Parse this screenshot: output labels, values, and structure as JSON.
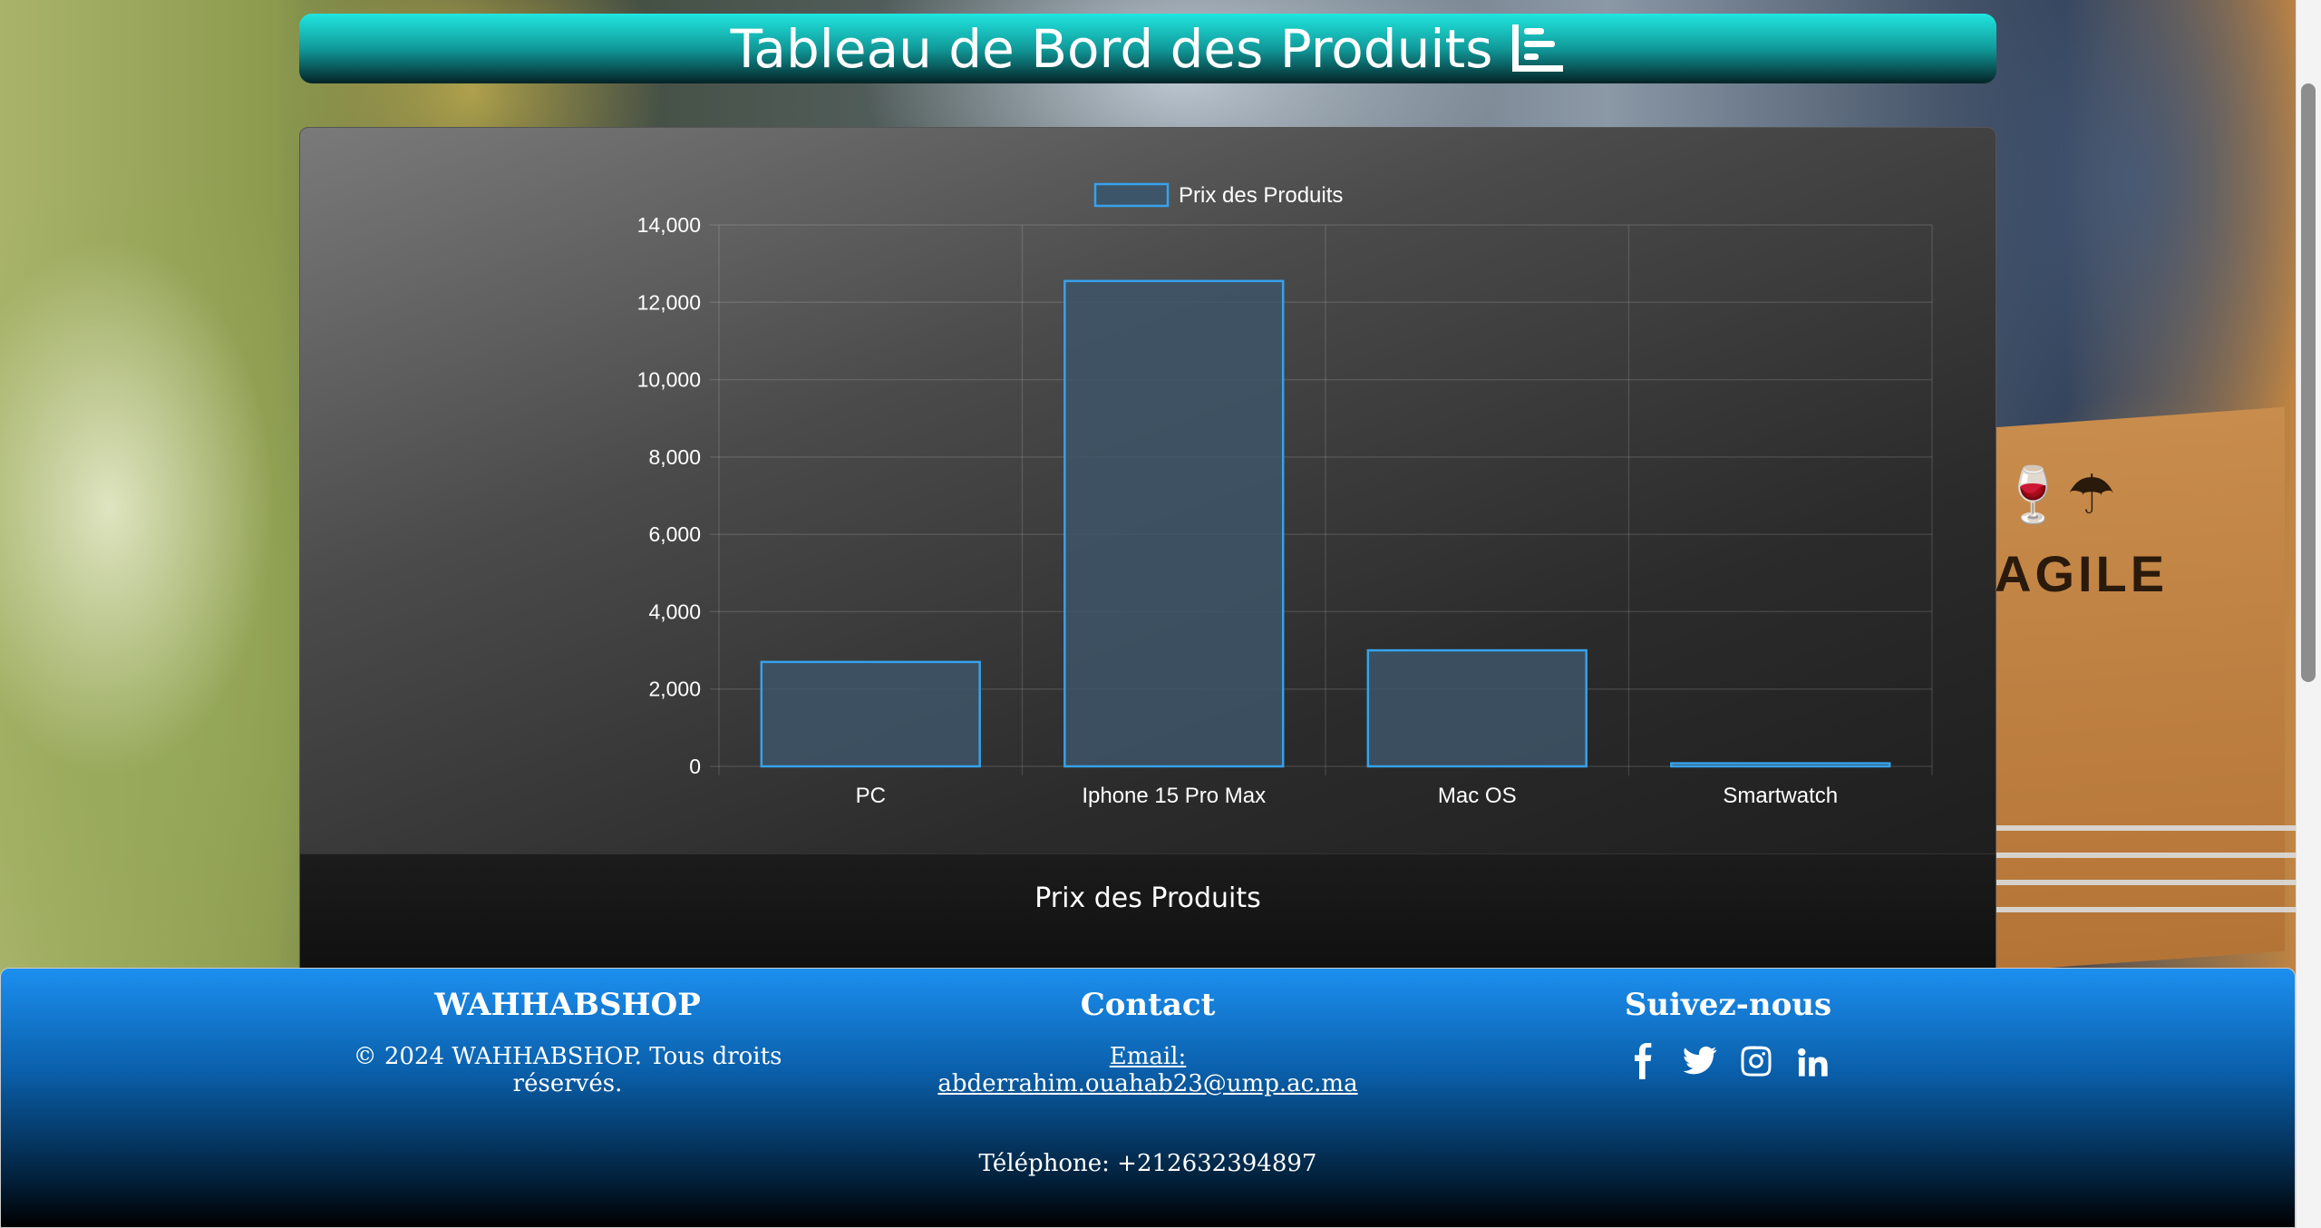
{
  "header": {
    "title": "Tableau de Bord des Produits",
    "icon": "bar-chart-icon"
  },
  "chart_data": {
    "type": "bar",
    "categories": [
      "PC",
      "Iphone 15 Pro Max",
      "Mac OS",
      "Smartwatch"
    ],
    "series": [
      {
        "name": "Prix des Produits",
        "values": [
          2700,
          12550,
          3000,
          80
        ]
      }
    ],
    "ylim": [
      0,
      14000
    ],
    "yticks": [
      "0",
      "2,000",
      "4,000",
      "6,000",
      "8,000",
      "10,000",
      "12,000",
      "14,000"
    ],
    "legend": "top-center",
    "grid": true,
    "bar_fill": "#3d5568",
    "bar_border": "#36a2eb"
  },
  "card": {
    "footer_title": "Prix des Produits"
  },
  "footer": {
    "brand": "WAHHABSHOP",
    "copyright": "© 2024 WAHHABSHOP. Tous droits réservés.",
    "contact_title": "Contact",
    "email": "Email: abderrahim.ouahab23@ump.ac.ma",
    "phone": "Téléphone: +212632394897",
    "follow_title": "Suivez-nous",
    "social": [
      "facebook-icon",
      "twitter-icon",
      "instagram-icon",
      "linkedin-icon"
    ]
  },
  "box_label": "AGILE"
}
